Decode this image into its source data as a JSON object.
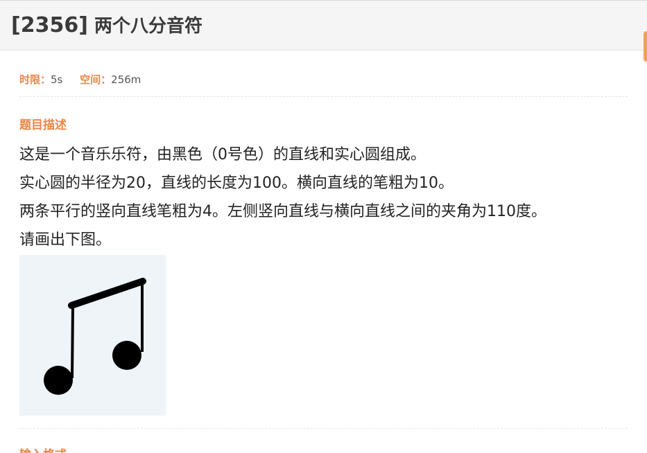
{
  "problem": {
    "id": "[2356]",
    "name": "两个八分音符"
  },
  "limits": {
    "time_label": "时限：",
    "time_value": "5s",
    "memory_label": "空间：",
    "memory_value": "256m"
  },
  "sections": {
    "description_title": "题目描述",
    "input_title": "输入格式"
  },
  "description": {
    "lines": [
      "这是一个音乐乐符，由黑色（0号色）的直线和实心圆组成。",
      "实心圆的半径为20，直线的长度为100。横向直线的笔粗为10。",
      "两条平行的竖向直线笔粗为4。左侧竖向直线与横向直线之间的夹角为110度。",
      "请画出下图。"
    ]
  },
  "colors": {
    "accent": "#e8874a",
    "header_bg": "#f5f5f5",
    "figure_bg": "#eef4f8"
  },
  "figure": {
    "icon": "eighth-notes-icon"
  }
}
